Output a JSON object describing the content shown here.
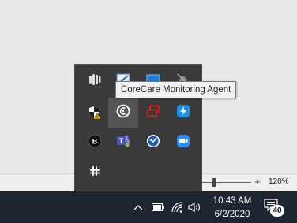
{
  "tray_popup": {
    "tooltip": "CoreCare Monitoring Agent",
    "icons": [
      {
        "name": "meeting-app-icon"
      },
      {
        "name": "network-drive-icon"
      },
      {
        "name": "display-manager-icon"
      },
      {
        "name": "disconnected-plug-icon"
      },
      {
        "name": "security-shield-warning-icon"
      },
      {
        "name": "corecare-monitoring-agent-icon"
      },
      {
        "name": "display-switch-icon"
      },
      {
        "name": "thunderbolt-icon"
      },
      {
        "name": "beats-icon"
      },
      {
        "name": "teams-icon"
      },
      {
        "name": "sync-client-icon"
      },
      {
        "name": "zoom-icon"
      },
      {
        "name": "slack-icon"
      }
    ]
  },
  "statusbar": {
    "zoom_plus": "+",
    "zoom_level": "120%",
    "zoom_fraction": 0.3
  },
  "taskbar": {
    "time": "10:43 AM",
    "date": "6/2/2020",
    "notification_count": "40"
  }
}
